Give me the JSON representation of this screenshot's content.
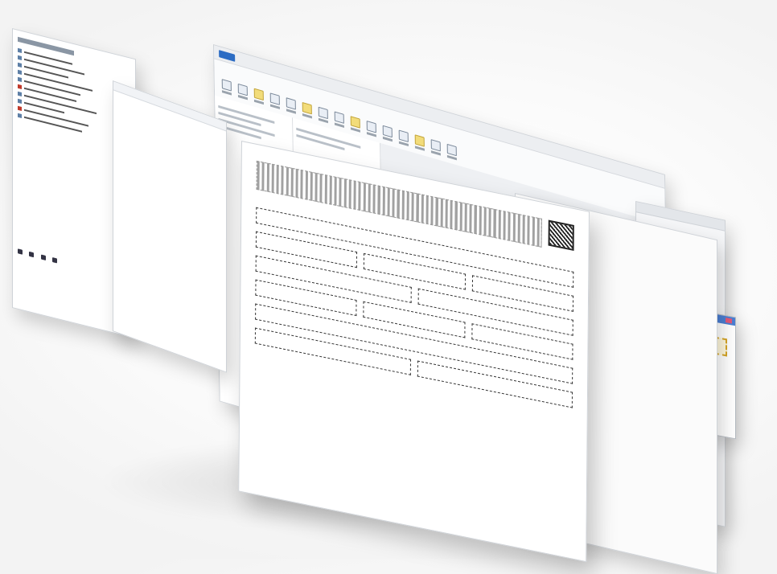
{
  "app": {
    "title": "",
    "accent_color": "#2b6cc4"
  },
  "form": {
    "heading_left": "",
    "heading_right": "",
    "section_label": ""
  },
  "list_panel": {
    "items": [
      {
        "label": ""
      },
      {
        "label": ""
      },
      {
        "label": ""
      },
      {
        "label": ""
      },
      {
        "label": ""
      }
    ]
  }
}
